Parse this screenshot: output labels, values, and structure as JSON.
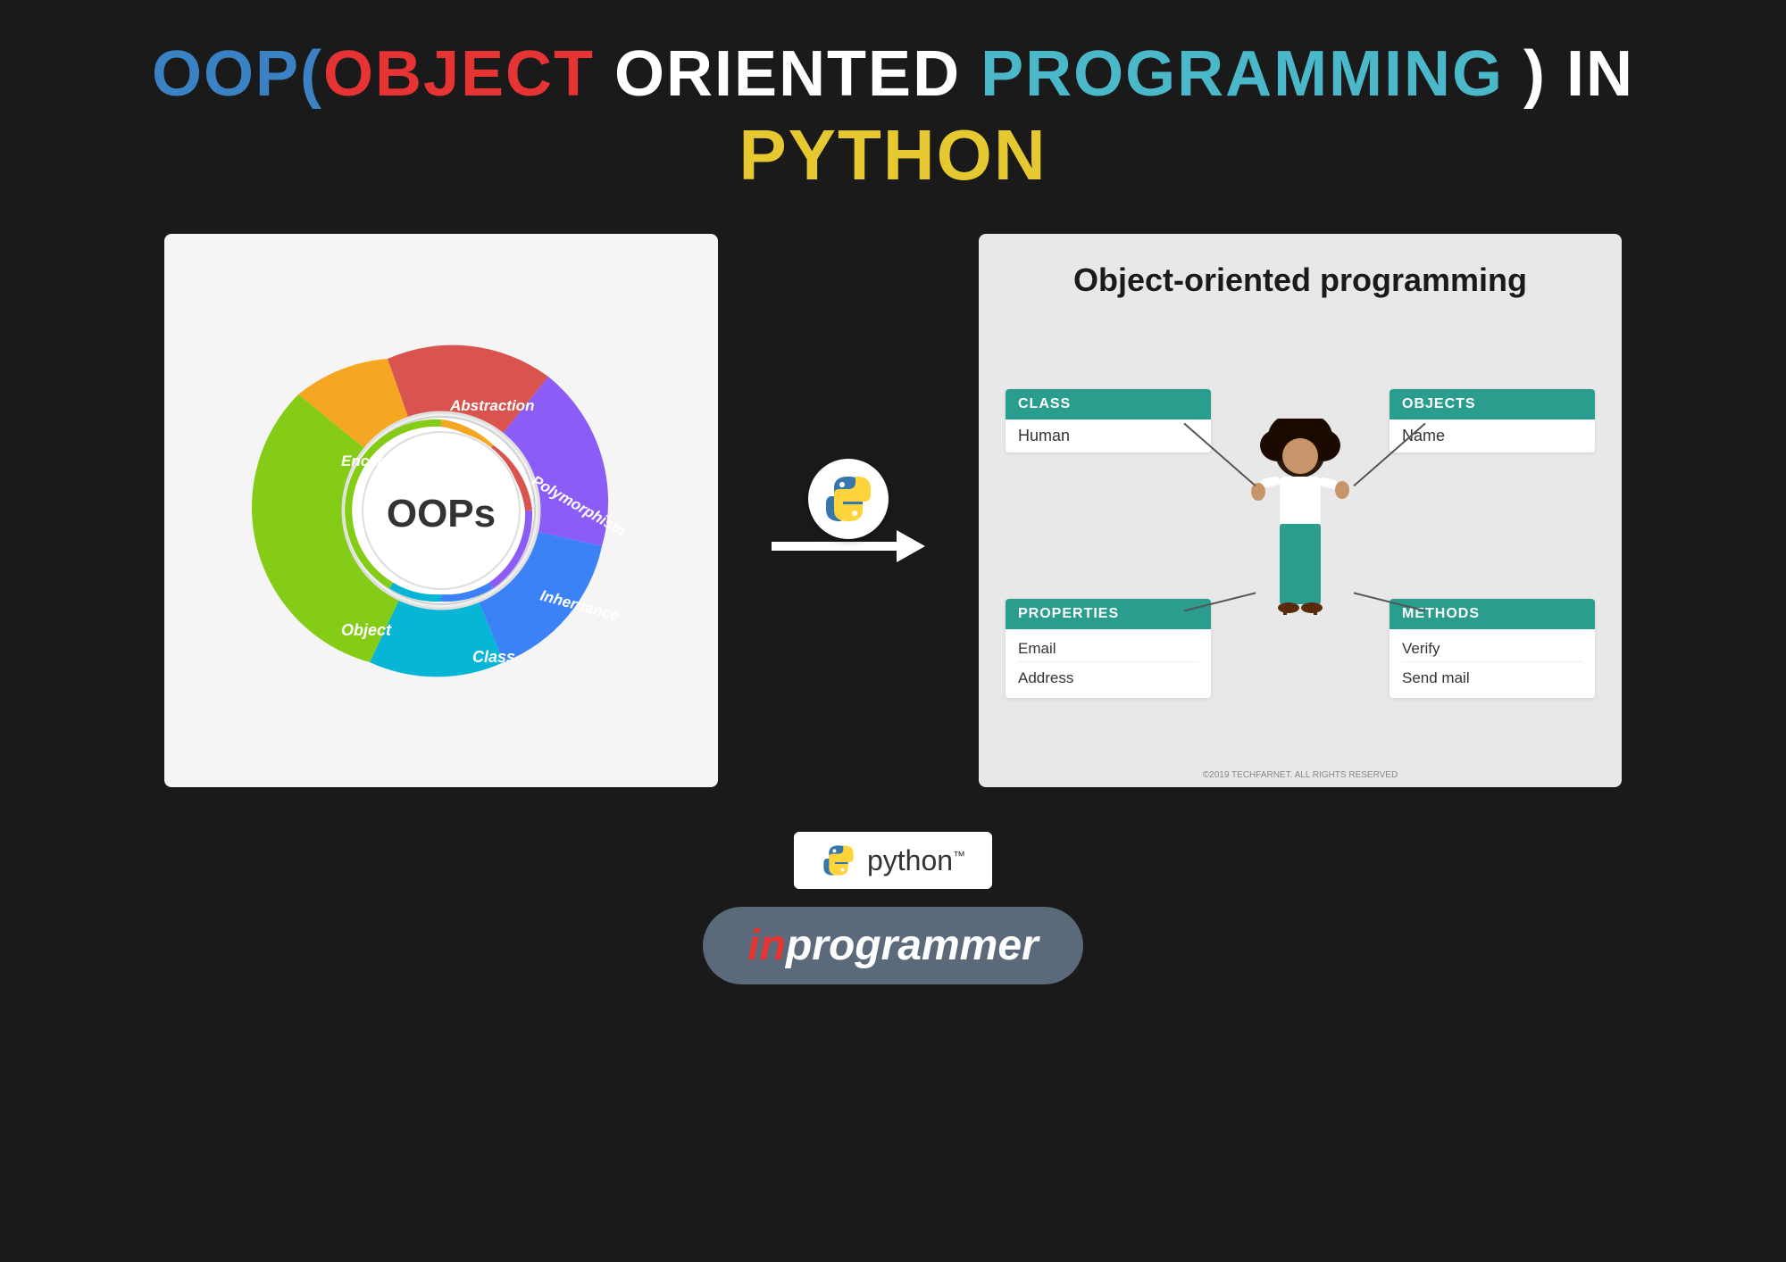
{
  "title": {
    "line1_part1": "OOP(",
    "line1_part2": "OBJECT",
    "line1_part3": " ORIENTED ",
    "line1_part4": "PROGRAMMING",
    "line1_part5": " ) IN",
    "line2": "PYTHON"
  },
  "oops_diagram": {
    "center_text": "OOPs",
    "petals": [
      {
        "label": "Encapsulation",
        "color": "#f5a623"
      },
      {
        "label": "Abstraction",
        "color": "#d9534f"
      },
      {
        "label": "Polymorphism",
        "color": "#8b5cf6"
      },
      {
        "label": "Inheritance",
        "color": "#3b82f6"
      },
      {
        "label": "Class",
        "color": "#06b6d4"
      },
      {
        "label": "Object",
        "color": "#84cc16"
      }
    ]
  },
  "oop_panel": {
    "title": "Object-oriented\nprogramming",
    "class_header": "CLASS",
    "class_value": "Human",
    "objects_header": "OBJECTS",
    "objects_value": "Name",
    "properties_header": "PROPERTIES",
    "properties_values": [
      "Email",
      "Address"
    ],
    "methods_header": "METHODS",
    "methods_values": [
      "Verify",
      "Send mail"
    ],
    "copyright": "©2019 TECHFARNET. ALL RIGHTS RESERVED"
  },
  "python_badge": {
    "text": "python™"
  },
  "brand": {
    "in": "in",
    "programmer": "programmer"
  }
}
